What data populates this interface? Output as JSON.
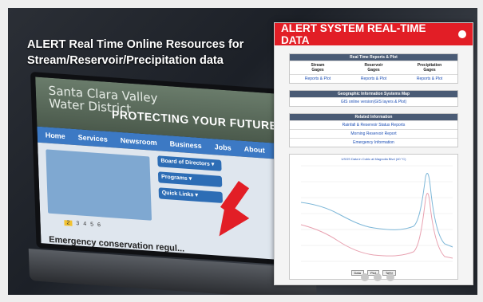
{
  "banner": {
    "title_line1": "ALERT Real Time Online Resources for",
    "title_line2": "Stream/Reservoir/Precipitation data"
  },
  "website": {
    "logo_line1": "Santa Clara Valley",
    "logo_line2": "Water District",
    "tagline": "PROTECTING YOUR FUTURE",
    "nav": [
      "Home",
      "Services",
      "Newsroom",
      "Business",
      "Jobs",
      "About"
    ],
    "side_buttons": [
      "Board of Directors ▾",
      "Programs ▾",
      "Quick Links ▾"
    ],
    "pager": [
      "2",
      "3",
      "4",
      "5",
      "6"
    ],
    "headline": "Emergency conservation regul..."
  },
  "panel": {
    "header": "ALERT SYSTEM REAL-TIME DATA",
    "table1": {
      "heading": "Real Time Reports & Plot",
      "columns": [
        "Stream\nGages",
        "Reservoir\nGages",
        "Precipitation\nGages"
      ],
      "links": [
        "Reports & Plot",
        "Reports & Plot",
        "Reports & Plot"
      ]
    },
    "table2": {
      "heading": "Geographic Information Systems Map",
      "link": "GIS online version(GIS layers & Plot)"
    },
    "table3": {
      "heading": "Related Information",
      "links": [
        "Rainfall & Reservoir Status Reports",
        "Morning Reservoir Report",
        "Emergency Information"
      ]
    },
    "chart": {
      "title": "USGS Data in Cubic at Magnolia Blvd (40 °C)",
      "buttons": [
        "Data",
        "Plot",
        "Table"
      ]
    }
  },
  "carousel_dots": 3,
  "colors": {
    "accent": "#e21e26",
    "nav_blue": "#3c79c4",
    "table_header": "#4a5b75",
    "link": "#1d4fb5"
  }
}
